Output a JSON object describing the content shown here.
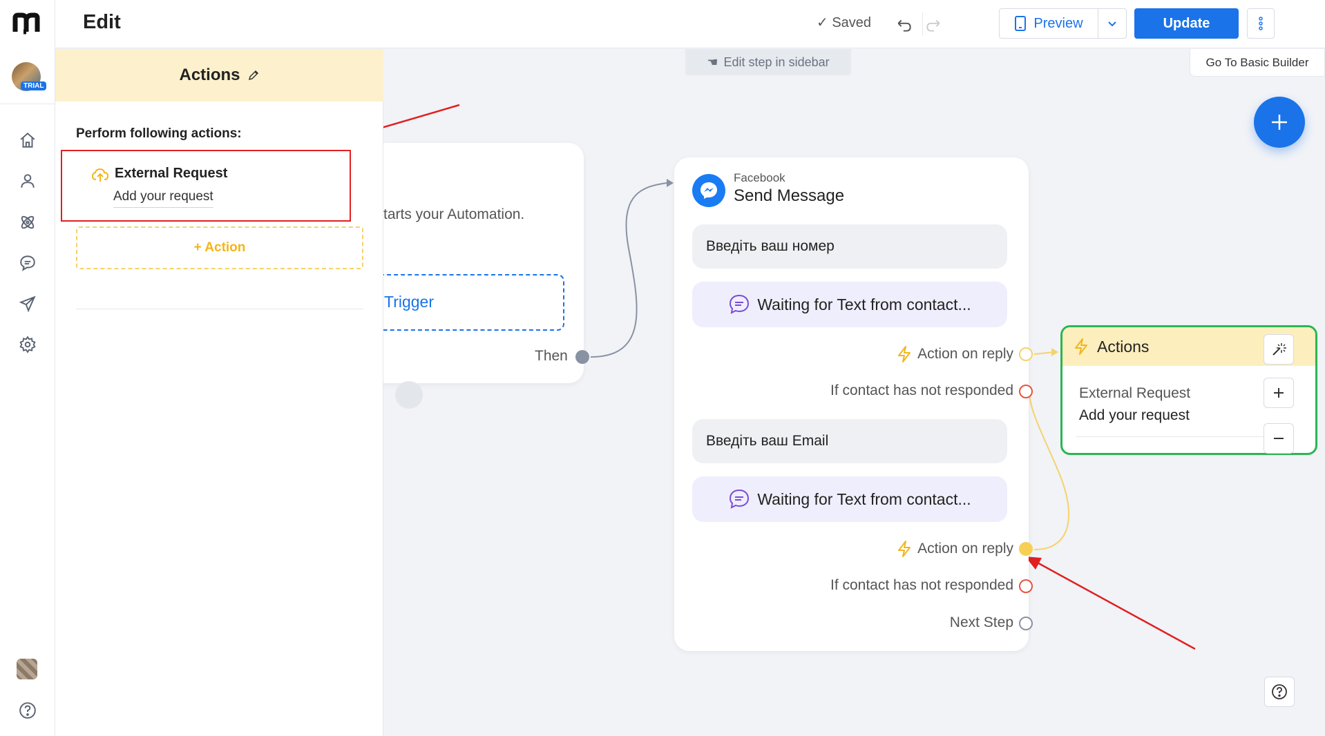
{
  "app": {
    "logo": "m-logo",
    "trial_badge": "TRIAL"
  },
  "header": {
    "title": "Edit",
    "saved_label": "Saved",
    "preview_label": "Preview",
    "update_label": "Update"
  },
  "nav": {
    "items": [
      "home-icon",
      "contacts-icon",
      "automation-icon",
      "chat-icon",
      "broadcast-icon",
      "settings-icon"
    ],
    "help": "help-icon"
  },
  "panel": {
    "title": "Actions",
    "perform_label": "Perform following actions:",
    "action_item": {
      "title": "External Request",
      "subtitle": "Add your request"
    },
    "add_action_label": "+ Action"
  },
  "canvas": {
    "hint": "Edit step in sidebar",
    "basic_builder": "Go To Basic Builder",
    "trigger": {
      "description": "tarts your Automation.",
      "trigger_label": "Trigger",
      "then_label": "Then"
    },
    "message": {
      "channel": "Facebook",
      "title": "Send Message",
      "box1": "Введіть ваш номер",
      "wait1": "Waiting for Text from contact...",
      "reply1": "Action on reply",
      "noresp1": "If contact has not responded",
      "box2": "Введіть ваш Email",
      "wait2": "Waiting for Text from contact...",
      "reply2": "Action on reply",
      "noresp2": "If contact has not responded",
      "next_step": "Next Step"
    },
    "actions_node": {
      "title": "Actions",
      "item_title": "External Request",
      "item_subtitle": "Add your request"
    }
  },
  "colors": {
    "accent": "#1a73e8",
    "action_yellow": "#f2b51c",
    "annotation_red": "#e02020",
    "node_green": "#2bb552"
  }
}
